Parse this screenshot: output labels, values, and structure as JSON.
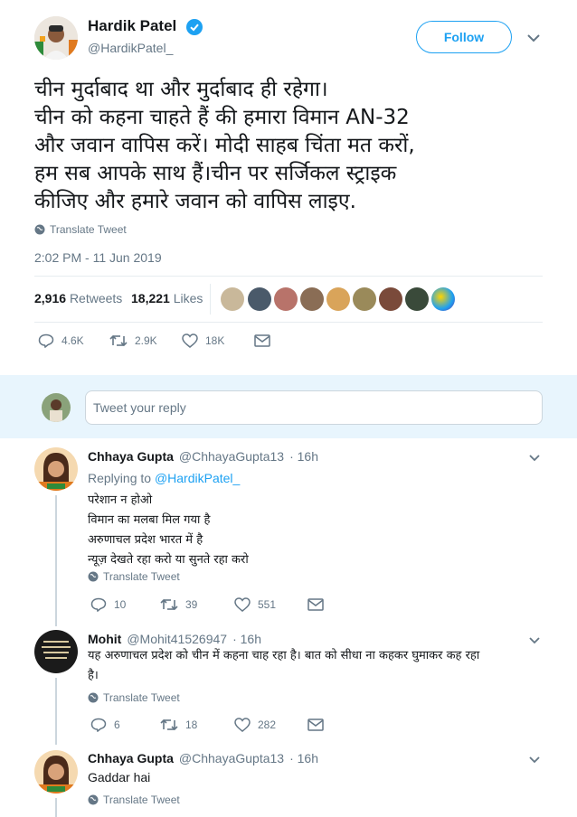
{
  "tweet": {
    "author_name": "Hardik Patel",
    "author_handle": "@HardikPatel_",
    "follow_label": "Follow",
    "text_lines": [
      "चीन मुर्दाबाद था और मुर्दाबाद ही रहेगा।",
      "चीन को कहना चाहते हैं की हमारा विमान AN-32",
      "और जवान वापिस करें। मोदी साहब चिंता मत करों,",
      "हम सब आपके साथ हैं।चीन पर सर्जिकल स्ट्राइक",
      "कीजिए और हमारे जवान को वापिस लाइए."
    ],
    "translate_label": "Translate Tweet",
    "timestamp": "2:02 PM - 11 Jun 2019",
    "retweets_count": "2,916",
    "retweets_label": "Retweets",
    "likes_count": "18,221",
    "likes_label": "Likes",
    "actions": {
      "replies": "4.6K",
      "retweets": "2.9K",
      "likes": "18K"
    }
  },
  "reply_input": {
    "placeholder": "Tweet your reply"
  },
  "replies": [
    {
      "name": "Chhaya Gupta",
      "handle": "@ChhayaGupta13",
      "time": "· 16h",
      "replying_to_label": "Replying to",
      "replying_to_handle": "@HardikPatel_",
      "text_lines": [
        "परेशान न होओ",
        "विमान का मलबा मिल गया है",
        "अरुणाचल प्रदेश भारत में है",
        "न्यूज़ देखते रहा करो या सुनते रहा करो"
      ],
      "translate_label": "Translate Tweet",
      "actions": {
        "replies": "10",
        "retweets": "39",
        "likes": "551"
      }
    },
    {
      "name": "Mohit",
      "handle": "@Mohit41526947",
      "time": "· 16h",
      "text_lines": [
        "यह अरुणाचल प्रदेश को चीन में कहना चाह रहा है। बात को सीधा ना कहकर घुमाकर कह रहा",
        "है।"
      ],
      "translate_label": "Translate Tweet",
      "actions": {
        "replies": "6",
        "retweets": "18",
        "likes": "282"
      }
    },
    {
      "name": "Chhaya Gupta",
      "handle": "@ChhayaGupta13",
      "time": "· 16h",
      "text_lines": [
        "Gaddar hai"
      ],
      "translate_label": "Translate Tweet"
    }
  ],
  "colors": {
    "accent": "#1da1f2",
    "gray": "#657786",
    "divider": "#e6ecf0",
    "verified": "#1da1f2"
  },
  "icons": [
    "verified-badge-icon",
    "chevron-down-icon",
    "globe-icon",
    "reply-icon",
    "retweet-icon",
    "heart-icon",
    "envelope-icon"
  ]
}
